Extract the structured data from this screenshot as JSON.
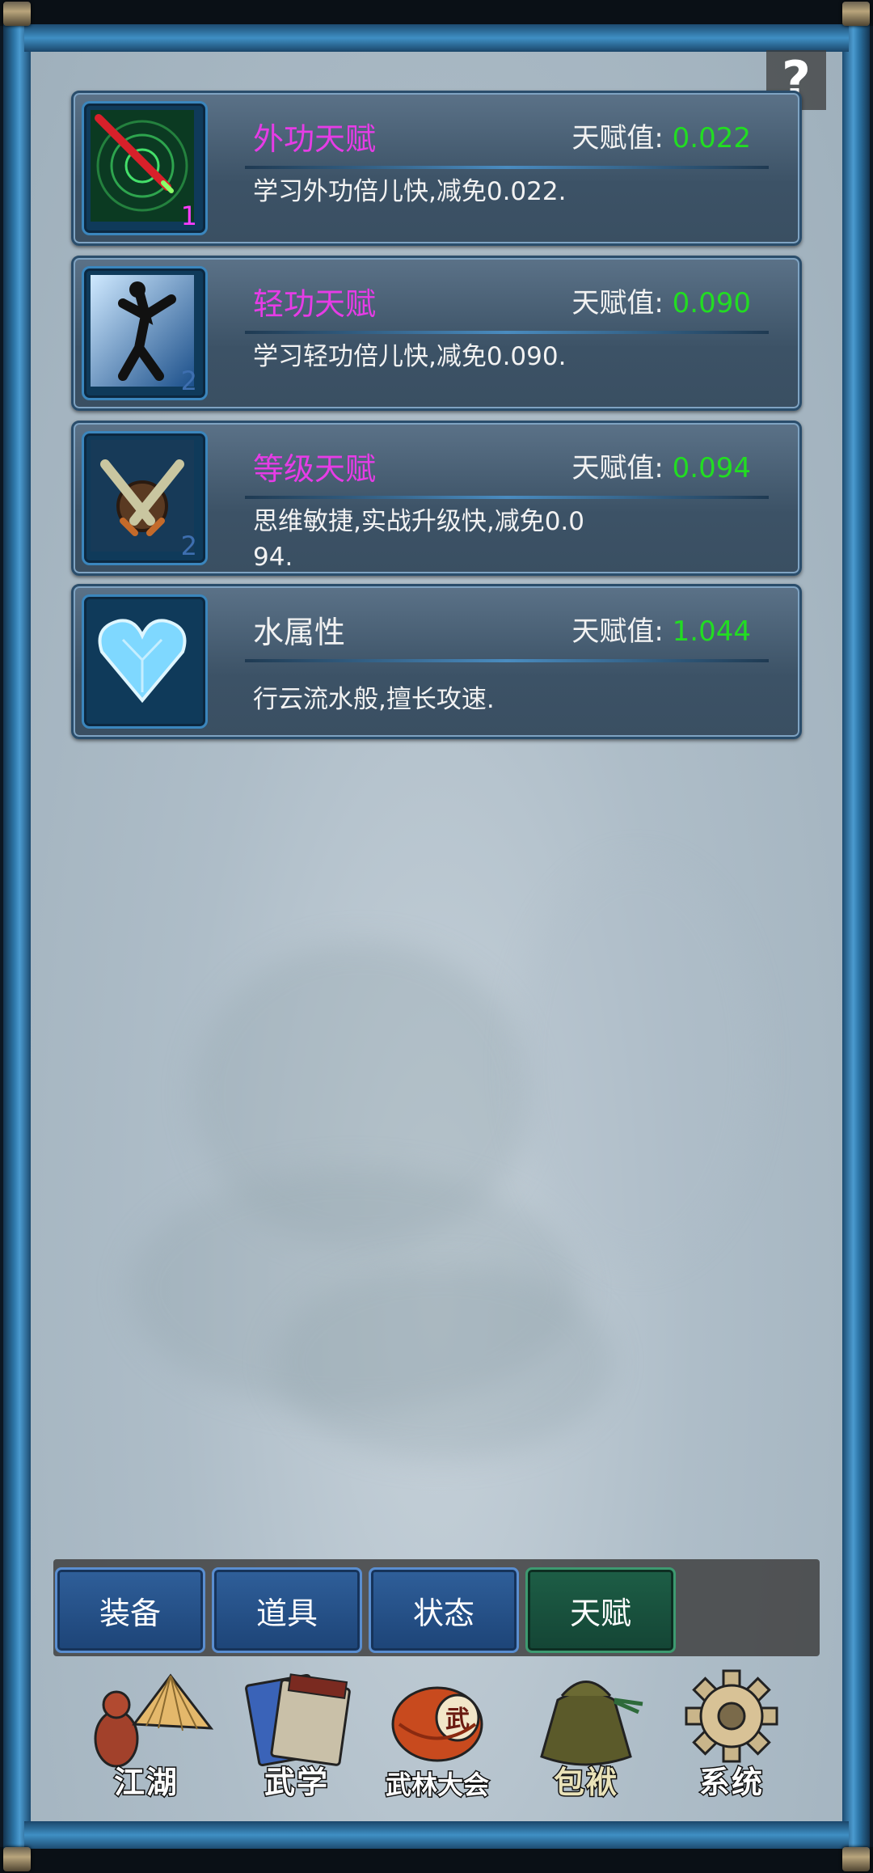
{
  "help": {
    "label": "?"
  },
  "talents": [
    {
      "name": "外功天赋",
      "name_color": "#e63ce6",
      "value_label": "天赋值:",
      "value": "0.022",
      "description": "学习外功倍儿快,减免0.022.",
      "level": "1",
      "level_color": "#ff3cff",
      "icon": "sword-slash-icon"
    },
    {
      "name": "轻功天赋",
      "name_color": "#e63ce6",
      "value_label": "天赋值:",
      "value": "0.090",
      "description": "学习轻功倍儿快,减免0.090.",
      "level": "2",
      "level_color": "#3e6fb0",
      "icon": "leaping-figure-icon"
    },
    {
      "name": "等级天赋",
      "name_color": "#e63ce6",
      "value_label": "天赋值:",
      "value": "0.094",
      "description": "思维敏捷,实战升级快,减免0.094.",
      "level": "2",
      "level_color": "#3e6fb0",
      "icon": "crossed-swords-icon"
    },
    {
      "name": "水属性",
      "name_color": "#f2f2f2",
      "value_label": "天赋值:",
      "value": "1.044",
      "description": "行云流水般,擅长攻速.",
      "level": "",
      "level_color": "#3e6fb0",
      "icon": "ice-heart-icon"
    }
  ],
  "tabs": [
    {
      "label": "装备",
      "active": false
    },
    {
      "label": "道具",
      "active": false
    },
    {
      "label": "状态",
      "active": false
    },
    {
      "label": "天赋",
      "active": true
    }
  ],
  "nav": [
    {
      "label": "江湖",
      "icon": "straw-hat-gourd-icon"
    },
    {
      "label": "武学",
      "icon": "book-scroll-icon"
    },
    {
      "label": "武林大会",
      "icon": "war-drum-icon"
    },
    {
      "label": "包袱",
      "icon": "cloth-bag-icon"
    },
    {
      "label": "系统",
      "icon": "gear-icon"
    }
  ]
}
